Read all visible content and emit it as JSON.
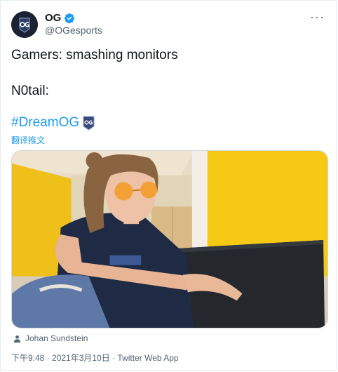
{
  "tweet": {
    "display_name": "OG",
    "handle": "@OGesports",
    "line1": "Gamers: smashing monitors",
    "line2": "N0tail:",
    "hashtag": "#DreamOG",
    "translate_label": "翻译推文",
    "photo_credit": "Johan Sundstein",
    "timestamp": "下午9:48 · 2021年3月10日",
    "separator": " · ",
    "source": "Twitter Web App"
  },
  "icons": {
    "avatar": "og-logo",
    "verified": "verified-badge-icon",
    "more": "more-options-icon",
    "hashtag_emoji": "og-emoji-icon",
    "credit": "person-icon"
  },
  "colors": {
    "link": "#1d9bf0",
    "secondary_text": "#536471",
    "verified": "#1d9bf0"
  }
}
